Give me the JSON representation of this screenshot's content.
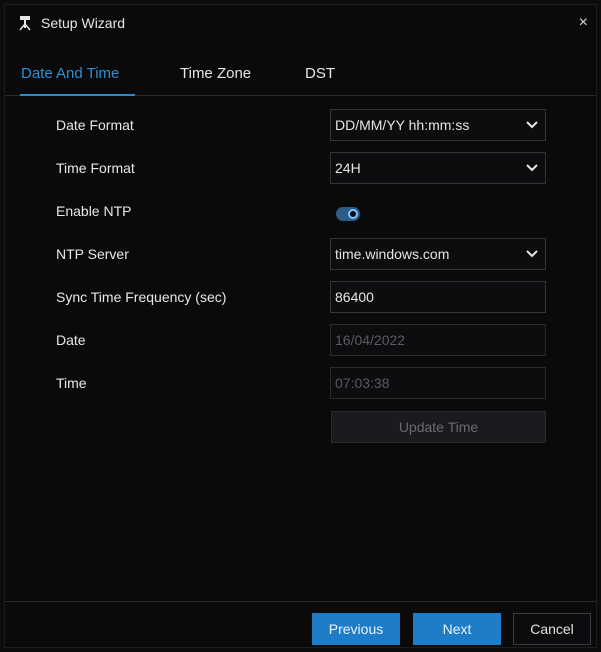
{
  "window": {
    "title": "Setup Wizard",
    "close_label": "×"
  },
  "tabs": [
    {
      "label": "Date And Time",
      "active": true
    },
    {
      "label": "Time Zone",
      "active": false
    },
    {
      "label": "DST",
      "active": false
    }
  ],
  "form": {
    "date_format": {
      "label": "Date Format",
      "value": "DD/MM/YY hh:mm:ss"
    },
    "time_format": {
      "label": "Time Format",
      "value": "24H"
    },
    "enable_ntp": {
      "label": "Enable NTP",
      "enabled": true
    },
    "ntp_server": {
      "label": "NTP Server",
      "value": "time.windows.com"
    },
    "sync_frequency": {
      "label": "Sync Time Frequency (sec)",
      "value": "86400"
    },
    "date": {
      "label": "Date",
      "value": "16/04/2022"
    },
    "time": {
      "label": "Time",
      "value": "07:03:38"
    },
    "update_time_label": "Update Time"
  },
  "footer": {
    "previous_label": "Previous",
    "next_label": "Next",
    "cancel_label": "Cancel"
  },
  "colors": {
    "accent": "#2f8fd3",
    "primary_button": "#1f7cc7",
    "background": "#0a0a0b"
  },
  "icons": {
    "title": "tripod-camera-icon",
    "dropdown": "chevron-down-icon",
    "close": "close-icon"
  }
}
